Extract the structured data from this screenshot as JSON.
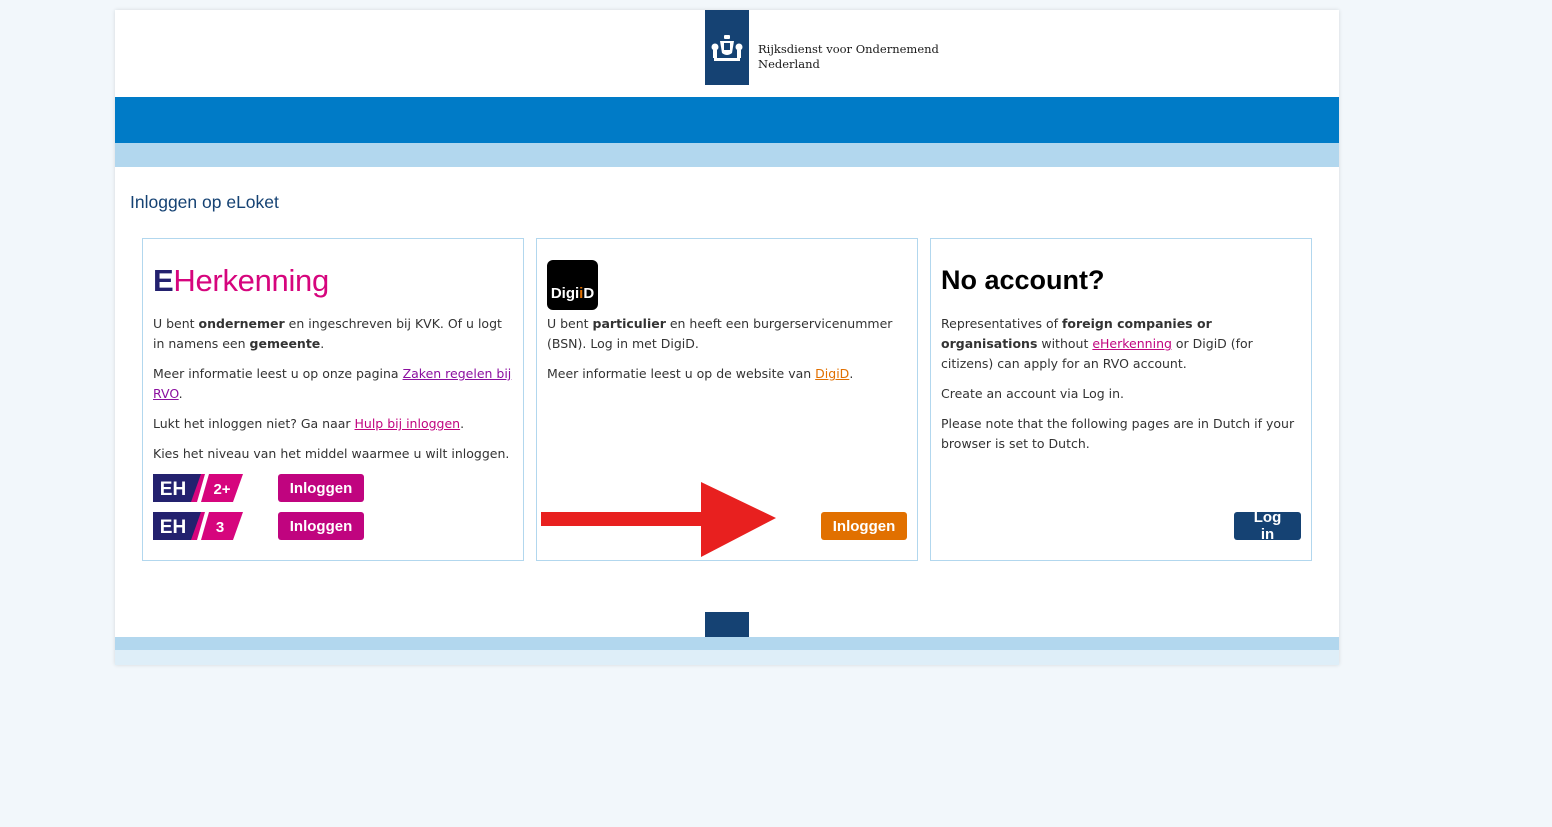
{
  "header": {
    "org_name_line1": "Rijksdienst voor Ondernemend",
    "org_name_line2": "Nederland"
  },
  "page_title": "Inloggen op eLoket",
  "eherkenning": {
    "logo_e": "E",
    "logo_text": "Herkenning",
    "intro_1": "U bent ",
    "intro_bold1": "ondernemer",
    "intro_2": " en ingeschreven bij KVK. Of u logt in namens een ",
    "intro_bold2": "gemeente",
    "intro_3": ".",
    "info_prefix": "Meer informatie leest u op onze pagina ",
    "info_link": "Zaken regelen bij RVO",
    "info_suffix": ".",
    "help_prefix": "Lukt het inloggen niet? Ga naar ",
    "help_link": "Hulp bij inloggen",
    "help_suffix": ".",
    "level_text": "Kies het niveau van het middel waarmee u wilt inloggen.",
    "levels": [
      {
        "badge": "2+",
        "button": "Inloggen"
      },
      {
        "badge": "3",
        "button": "Inloggen"
      }
    ],
    "badge_letters": "EH"
  },
  "digid": {
    "icon_digi": "Digi",
    "icon_id": "D",
    "intro_1": "U bent ",
    "intro_bold": "particulier",
    "intro_2": " en heeft een burgerservicenummer (BSN). Log in met DigiD.",
    "info_prefix": "Meer informatie leest u op de website van ",
    "info_link": "DigiD",
    "info_suffix": ".",
    "button": "Inloggen"
  },
  "no_account": {
    "title": "No account?",
    "p1_a": "Representatives of ",
    "p1_bold": "foreign companies or organisations",
    "p1_b": " without ",
    "p1_link": "eHerkenning",
    "p1_c": " or DigiD (for citizens) can apply for an RVO account.",
    "p2": "Create an account via Log in.",
    "p3": "Please note that the following pages are in Dutch if your browser is set to Dutch.",
    "button": "Log in"
  },
  "colors": {
    "brand_blue": "#007bc7",
    "navy": "#154273",
    "light_blue": "#b2d7ee",
    "eh_magenta": "#c0047f",
    "digid_orange": "#e17000",
    "annotation_arrow": "#e8201f"
  }
}
